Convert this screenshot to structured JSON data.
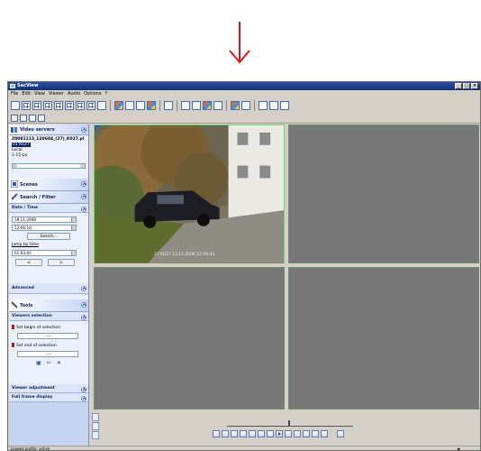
{
  "window": {
    "title": "SacView"
  },
  "menu": [
    "File",
    "Edit",
    "View",
    "Viewer",
    "Audio",
    "Options",
    "?"
  ],
  "panel": {
    "video_servers": {
      "title": "Video servers",
      "filename": "20081113_120604_(27)_K027.pl",
      "selected_item": "01 K027",
      "line2": "Local",
      "line3": "1-15-ps"
    },
    "scenes": {
      "title": "Scenes"
    },
    "search_filter": {
      "title": "Search / Filter",
      "date_time_label": "Date / Time",
      "date_value": "18.11.2008",
      "time_value": "12:06:10",
      "search_button": "Search...",
      "jump_label": "Jump by time",
      "jump_value": "01:03:00"
    },
    "advanced": {
      "title": "Advanced"
    },
    "tools": {
      "title": "Tools",
      "viewers_selection": "Viewers selection",
      "set_begin": "Set begin of selection",
      "begin_value": "----",
      "set_end": "Set end of selection",
      "end_value": "----",
      "viewer_adjustment": "Viewer adjustment",
      "full_frame_display": "Full frame display"
    }
  },
  "viewer": {
    "overlay_text": "27 K027 13.11.2008 12:06:41"
  },
  "status": {
    "text": "Loaded profile: active"
  },
  "colors": {
    "accent": "#0a246a",
    "arrow": "#e0141e",
    "active_border": "#6fdb6f"
  }
}
